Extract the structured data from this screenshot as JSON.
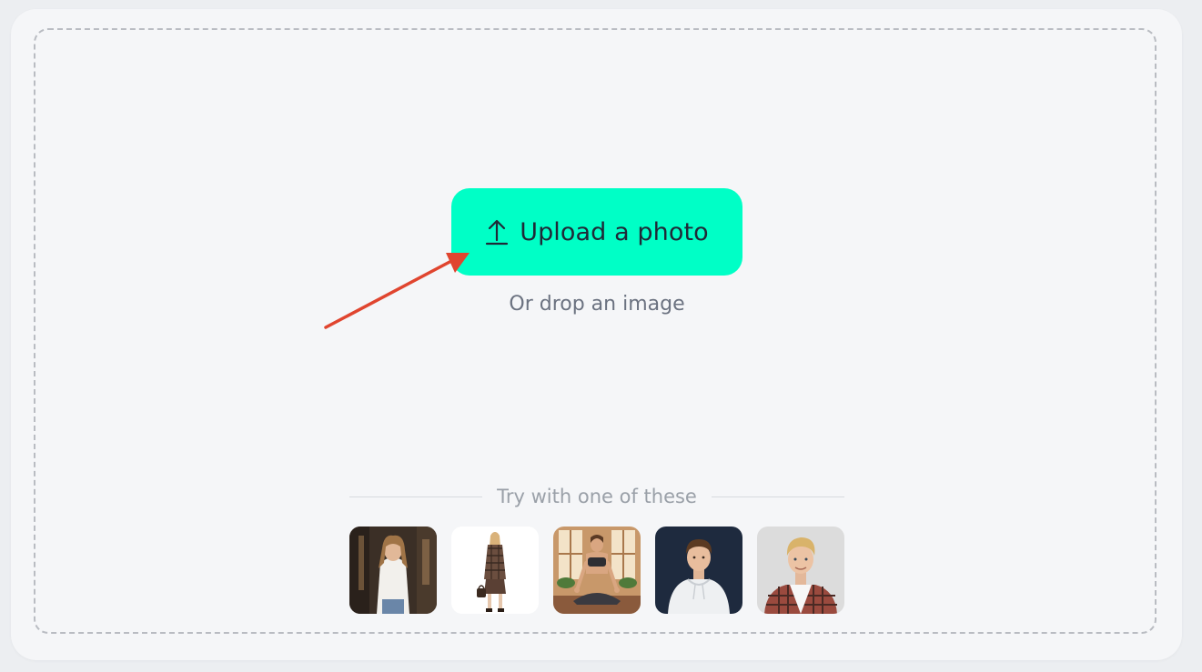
{
  "upload": {
    "button_label": "Upload a photo",
    "drop_hint": "Or drop an image",
    "icon": "upload-arrow-icon"
  },
  "samples": {
    "heading": "Try with one of these",
    "items": [
      {
        "name": "sample-woman-white-shirt"
      },
      {
        "name": "sample-woman-plaid-suit"
      },
      {
        "name": "sample-woman-yoga"
      },
      {
        "name": "sample-man-white-hoodie"
      },
      {
        "name": "sample-man-flannel-shirt"
      }
    ]
  },
  "colors": {
    "accent": "#00ffc6",
    "annotation_arrow": "#e0452f"
  }
}
